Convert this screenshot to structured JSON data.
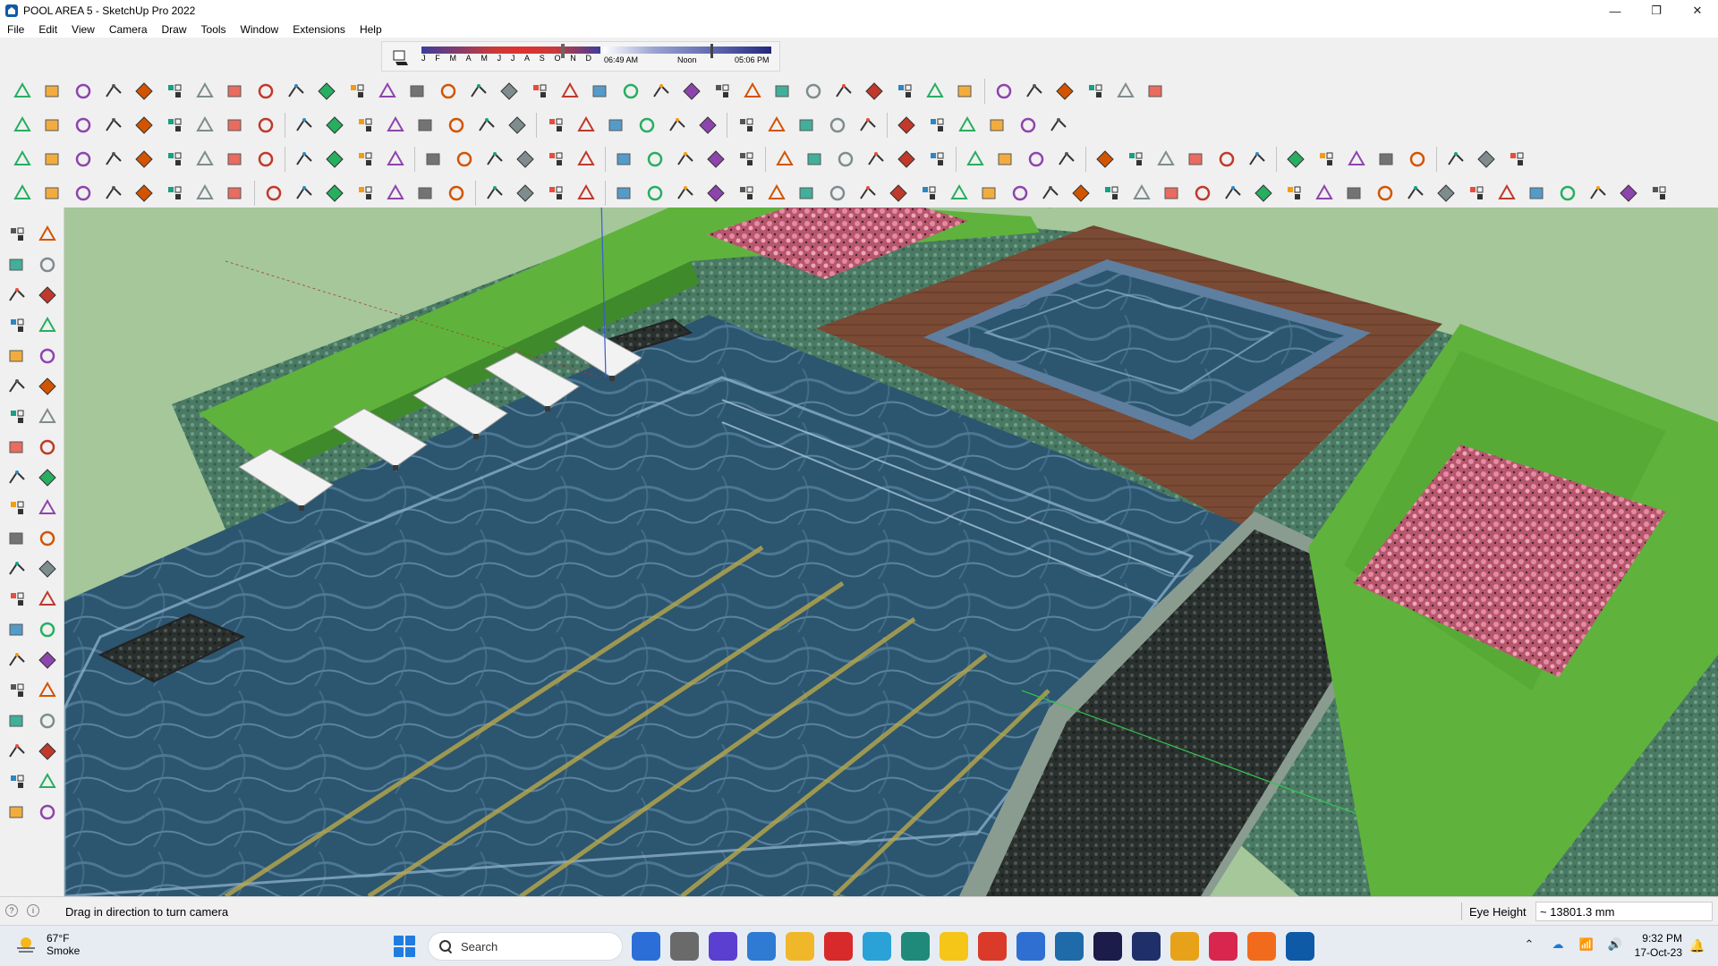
{
  "window": {
    "title": "POOL AREA 5 - SketchUp Pro 2022",
    "controls": [
      "—",
      "❐",
      "✕"
    ]
  },
  "menu": [
    "File",
    "Edit",
    "View",
    "Camera",
    "Draw",
    "Tools",
    "Window",
    "Extensions",
    "Help"
  ],
  "shadows": {
    "months": [
      "J",
      "F",
      "M",
      "A",
      "M",
      "J",
      "J",
      "A",
      "S",
      "O",
      "N",
      "D"
    ],
    "time_start": "06:49 AM",
    "time_mid": "Noon",
    "time_end": "05:06 PM"
  },
  "status": {
    "hint": "Drag in direction to turn camera",
    "vcb_label": "Eye Height",
    "vcb_value": "~ 13801.3 mm"
  },
  "taskbar": {
    "weather_temp": "67°F",
    "weather_condition": "Smoke",
    "search_label": "Search",
    "time": "9:32 PM",
    "date": "17-Oct-23"
  },
  "colors": {
    "grass": "#5fb33c",
    "water": "#2f5a78",
    "deck": "#7a4a34",
    "flowers": "#d46a86",
    "ground": "#a5c79a"
  }
}
